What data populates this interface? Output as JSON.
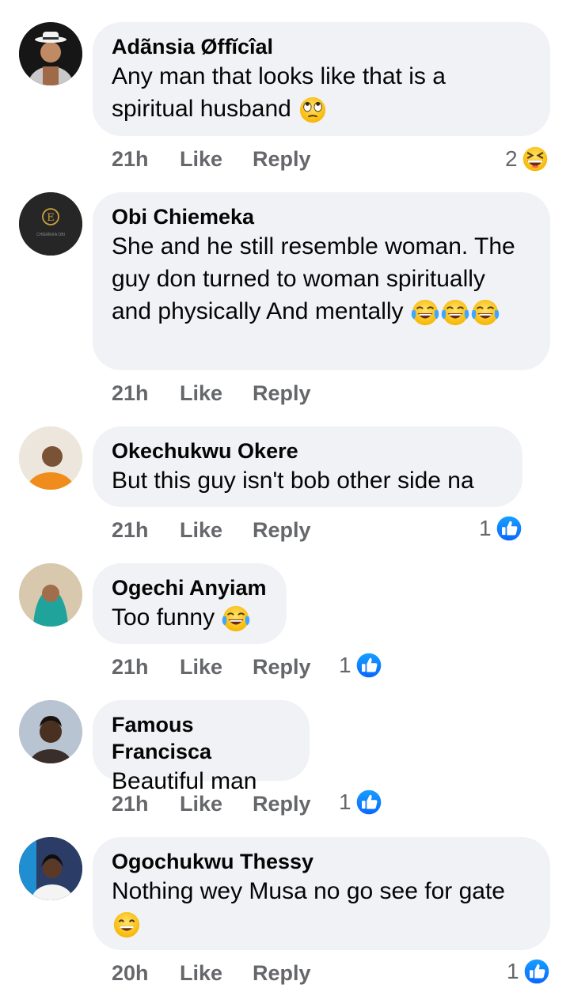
{
  "comments": [
    {
      "name": "Adãnsia Øffĭcîal",
      "text": "Any man that looks like that is a spiritual husband",
      "time": "21h",
      "like": "Like",
      "reply": "Reply",
      "reaction_count": "2",
      "reaction": "laughing-squint"
    },
    {
      "name": "Obi Chiemeka",
      "text": "She and he still resemble woman. The guy don turned to woman spiritually and physically And mentally",
      "time": "21h",
      "like": "Like",
      "reply": "Reply",
      "avatar_logo_letter": "E",
      "avatar_logo_text": "CHIEMEKA OBI"
    },
    {
      "name": "Okechukwu Okere",
      "text": "But this guy isn't bob other side na",
      "time": "21h",
      "like": "Like",
      "reply": "Reply",
      "reaction_count": "1",
      "reaction": "like"
    },
    {
      "name": "Ogechi Anyiam",
      "text": "Too funny",
      "time": "21h",
      "like": "Like",
      "reply": "Reply",
      "reaction_count": "1",
      "reaction": "like"
    },
    {
      "name": "Famous Francisca",
      "text": "Beautiful man",
      "time": "21h",
      "like": "Like",
      "reply": "Reply",
      "reaction_count": "1",
      "reaction": "like"
    },
    {
      "name": "Ogochukwu Thessy",
      "text": "Nothing wey Musa no go see for gate",
      "time": "20h",
      "like": "Like",
      "reply": "Reply",
      "reaction_count": "1",
      "reaction": "like"
    }
  ],
  "colors": {
    "bubble": "#f0f2f5",
    "meta": "#65676b",
    "like_blue": "#1877f2"
  }
}
